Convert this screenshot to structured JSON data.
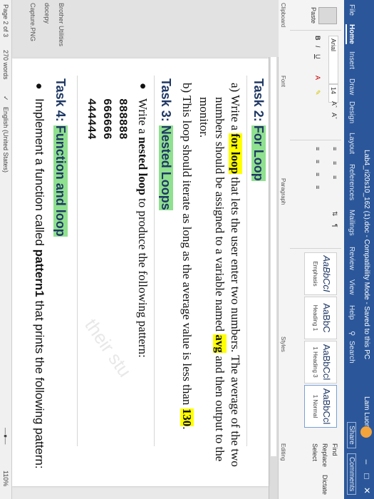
{
  "window": {
    "title": "Lab4_ri20s10_162 (1).doc - Compatibility Mode - Saved to this PC",
    "user": "Lam Luong",
    "minimize": "–",
    "restore": "□",
    "close": "✕"
  },
  "tabs": [
    "File",
    "Home",
    "Insert",
    "Draw",
    "Design",
    "Layout",
    "References",
    "Mailings",
    "Review",
    "View",
    "Help"
  ],
  "search_label": "Search",
  "share_label": "Share",
  "comments_label": "Comments",
  "ribbon": {
    "paste": "Paste",
    "clipboard": "Clipboard",
    "font_name": "Arial",
    "font_size": "14",
    "font_group": "Font",
    "paragraph_group": "Paragraph",
    "styles_group": "Styles",
    "editing_group": "Editing",
    "find": "Find",
    "replace": "Replace",
    "select": "Select",
    "dictate": "Dictate",
    "styles": [
      {
        "sample": "AaBbCcI",
        "name": "Emphasis"
      },
      {
        "sample": "AaBbC",
        "name": "Heading 1"
      },
      {
        "sample": "AaBbCcl",
        "name": "1 Heading 3"
      },
      {
        "sample": "AaBbCcl",
        "name": "1 Normal"
      }
    ]
  },
  "document": {
    "task2": "Task 2:",
    "task2_title": "For Loop",
    "a_1": "a) Write a ",
    "a_bold": "for loop",
    "a_2": " that lets the user enter two numbers. The average of the two",
    "a_3": "numbers should be assigned to a variable named ",
    "a_avg": "avg",
    "a_4": " and then output to the",
    "a_5": "monitor.",
    "b_1": "b) This loop should iterate as long as the average value is less than ",
    "b_val": "130",
    "b_end": ".",
    "task3": "Task 3:",
    "task3_title": "Nested Loops",
    "t3_1": "Write a ",
    "t3_bold": "nested loop",
    "t3_2": " to produce the following pattern:",
    "pattern": [
      "888888",
      "666666",
      "444444"
    ],
    "task4": "Task 4:",
    "task4_title": "Function and loop",
    "t4_1": "Implement a function called ",
    "t4_bold": "pattern1",
    "t4_2": " that prints the following pattern:",
    "watermark": "their stu"
  },
  "status": {
    "page": "Page 2 of 3",
    "words": "270 words",
    "language": "English (United States)",
    "zoom": "110%"
  },
  "desktop": [
    "Brother Utilities",
    "docepy",
    "Capture.PNG"
  ]
}
